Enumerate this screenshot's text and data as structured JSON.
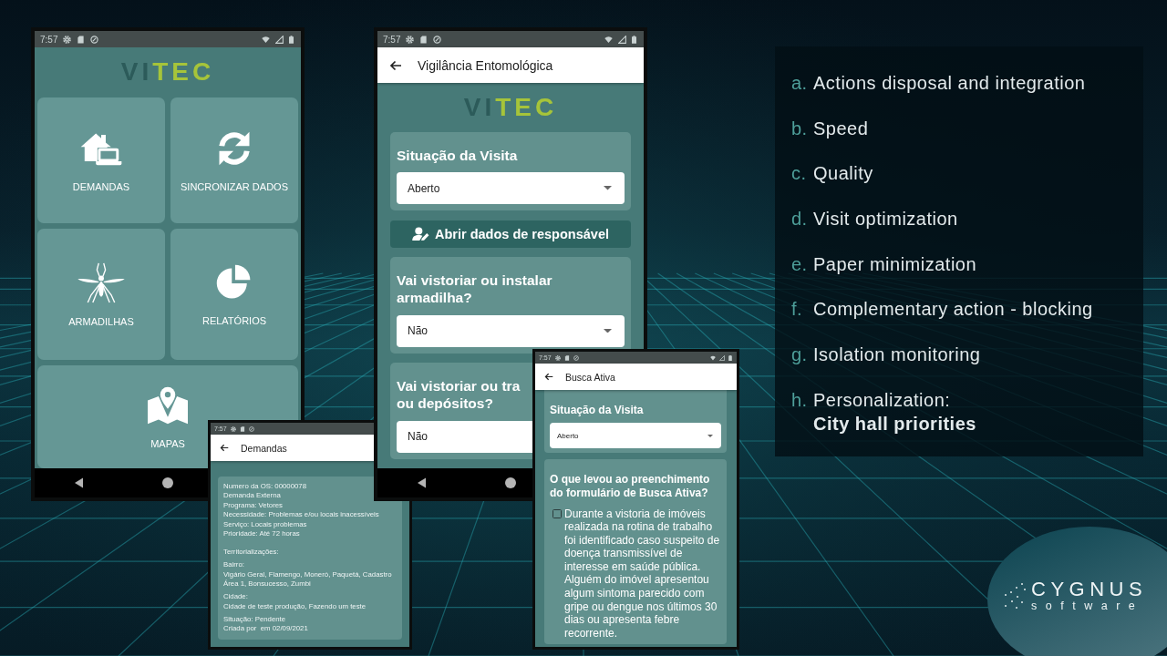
{
  "phones": [
    {
      "kind": "home",
      "status_time": "7:57",
      "logo": [
        {
          "text": "VI",
          "color": "#2c5b5a"
        },
        {
          "text": "TEC",
          "color": "#a6c43a"
        }
      ],
      "tiles": [
        {
          "kind": "house-laptop",
          "label": "DEMANDAS"
        },
        {
          "kind": "sync",
          "label": "SINCRONIZAR DADOS"
        },
        {
          "kind": "mosquito",
          "label": "ARMADILHAS"
        },
        {
          "kind": "pie",
          "label": "RELATÓRIOS"
        },
        {
          "kind": "map",
          "label": "MAPAS"
        }
      ]
    },
    {
      "kind": "form",
      "status_time": "7:57",
      "title": "Vigilância Entomológica",
      "logo": [
        {
          "text": "VI",
          "color": "#2c5b5a"
        },
        {
          "text": "TEC",
          "color": "#a6c43a"
        }
      ],
      "blocks": [
        {
          "kind": "select",
          "label": "Situação da Visita",
          "value": "Aberto"
        },
        {
          "kind": "button",
          "label": "Abrir dados de responsável"
        },
        {
          "kind": "select",
          "label": "Vai vistoriar ou instalar armadilha?",
          "value": "Não"
        },
        {
          "kind": "select",
          "label_lines": [
            "Vai vistoriar ou tra",
            "ou depósitos?"
          ],
          "value": "Não"
        }
      ]
    },
    {
      "kind": "details",
      "status_time": "7:57",
      "title": "Demandas",
      "sections": [
        {
          "lines": [
            "Numero da OS: 00000078",
            "Demanda Externa",
            "Programa: Vetores",
            "Necessidade: Problemas e/ou locais inacessíveis",
            "Serviço: Locais problemas",
            "Prioridade: Até 72 horas"
          ]
        },
        {
          "lines": [
            "Territorializações:"
          ]
        },
        {
          "lines": [
            "Bairro:",
            "Vigário Geral, Flamengo, Moneró, Paquetá, Cadastro Área 1, Bonsucesso, Zumbi"
          ]
        },
        {
          "lines": [
            "Cidade:",
            "Cidade de teste produção, Fazendo um teste"
          ]
        },
        {
          "lines": [
            "Situação: Pendente",
            "Criada por  em 02/09/2021"
          ]
        }
      ]
    },
    {
      "kind": "checklist",
      "status_time": "7:57",
      "title": "Busca Ativa",
      "blocks": [
        {
          "kind": "select",
          "label": "Situação da Visita",
          "value": "Aberto"
        },
        {
          "kind": "checkboxes",
          "label": "O que levou ao preenchimento do formulário de Busca Ativa?",
          "options": [
            {
              "text": "Durante a vistoria de imóveis realizada na rotina de trabalho foi identificado caso suspeito de doença transmissível de interesse em saúde pública. Alguém do imóvel apresentou algum sintoma parecido com gripe ou dengue nos últimos 30 dias ou apresenta febre recorrente.",
              "checked": false
            }
          ]
        }
      ]
    }
  ],
  "benefits": [
    {
      "marker": "a.",
      "text": "Actions disposal and integration"
    },
    {
      "marker": "b.",
      "text": "Speed"
    },
    {
      "marker": "c.",
      "text": "Quality"
    },
    {
      "marker": "d.",
      "text": "Visit optimization"
    },
    {
      "marker": "e.",
      "text": "Paper minimization"
    },
    {
      "marker": "f.",
      "text": "Complementary action - blocking"
    },
    {
      "marker": "g.",
      "text": "Isolation monitoring"
    },
    {
      "marker": "h.",
      "text": "Personalization:",
      "highlight": "City hall priorities"
    }
  ],
  "company_logo": {
    "name": "CYGNUS",
    "tagline": "software"
  }
}
